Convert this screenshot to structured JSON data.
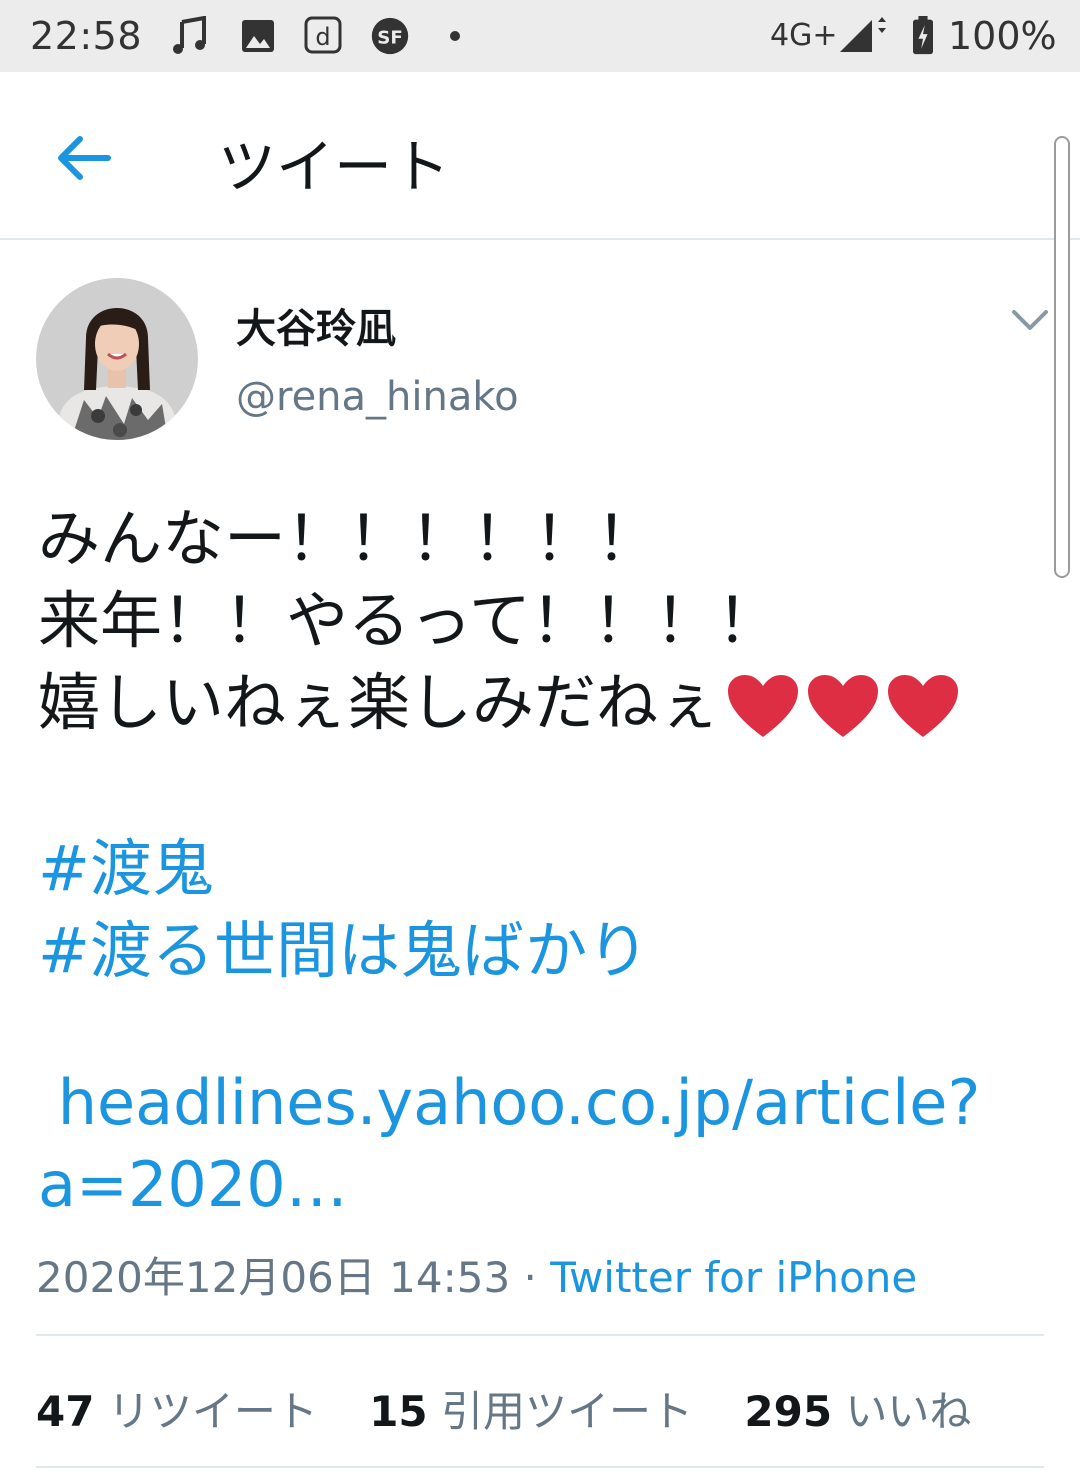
{
  "status_bar": {
    "time": "22:58",
    "network": "4G+",
    "battery": "100%",
    "icons": [
      "music-note-icon",
      "image-icon",
      "docomo-d-icon",
      "sf-app-icon",
      "dot-icon",
      "signal-icon",
      "battery-charging-icon"
    ]
  },
  "header": {
    "title": "ツイート",
    "back_icon": "arrow-left-icon",
    "accent_color": "#1b95e0"
  },
  "tweet": {
    "display_name": "大谷玲凪",
    "handle": "@rena_hinako",
    "lines": [
      "みんなー！！！！！！",
      "来年！！やるって！！！！",
      "嬉しいねぇ楽しみだねぇ"
    ],
    "hearts": [
      "red-heart-icon",
      "red-heart-icon",
      "red-heart-icon"
    ],
    "hashtags": [
      "#渡鬼",
      "#渡る世間は鬼ばかり"
    ],
    "link_lines": [
      " headlines.yahoo.co.jp/article?",
      "a=2020…"
    ],
    "timestamp": "2020年12月06日 14:53",
    "separator": " · ",
    "source": "Twitter for iPhone"
  },
  "stats": {
    "retweets_count": "47",
    "retweets_label": "リツイート",
    "quotes_count": "15",
    "quotes_label": "引用ツイート",
    "likes_count": "295",
    "likes_label": "いいね"
  }
}
